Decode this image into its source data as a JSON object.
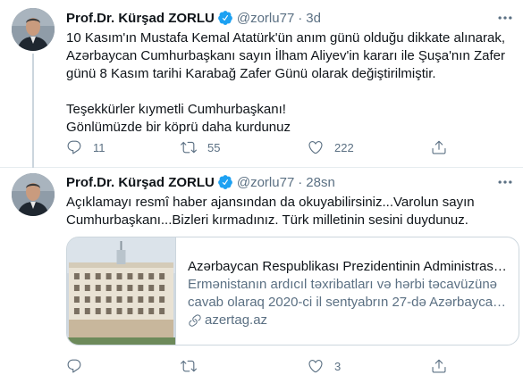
{
  "tweets": [
    {
      "author_name": "Prof.Dr. Kürşad ZORLU",
      "handle": "@zorlu77",
      "separator": "·",
      "time": "3d",
      "text_lines": [
        "10 Kasım'ın Mustafa Kemal Atatürk'ün anım günü olduğu dikkate alınarak,",
        "Azərbaycan Cumhurbaşkanı sayın İlham Aliyev'in kararı ile Şuşa'nın Zafer",
        "günü 8 Kasım tarihi Karabağ Zafer Günü olarak değiştirilmiştir.",
        "",
        "Teşekkürler kıymetli Cumhurbaşkanı!",
        "Gönlümüzde bir köprü daha kurdunuz"
      ],
      "replies": "11",
      "retweets": "55",
      "likes": "222"
    },
    {
      "author_name": "Prof.Dr. Kürşad ZORLU",
      "handle": "@zorlu77",
      "separator": "·",
      "time": "28sn",
      "text_lines": [
        "Açıklamayı resmî haber ajansından da okuyabilirsiniz...Varolun sayın",
        "Cumhurbaşkanı...Bizleri kırmadınız. Türk milletinin sesini duydunuz."
      ],
      "card": {
        "title": "Azərbaycan Respublikası Prezidentinin Administrasiy...",
        "description_lines": [
          "Ermənistanın ardıcıl təxribatları və hərbi təcavüzünə",
          "cavab olaraq 2020-ci il sentyabrın 27-də Azərbaycan ..."
        ],
        "domain": "azertag.az"
      },
      "replies": "",
      "retweets": "",
      "likes": "3"
    }
  ],
  "icons": {
    "verified": "verified-badge-icon",
    "more": "more-options-icon",
    "reply": "reply-icon",
    "retweet": "retweet-icon",
    "like": "heart-icon",
    "share": "share-icon",
    "link": "link-icon"
  },
  "colors": {
    "accent": "#1da1f2",
    "secondary_text": "#5b7083",
    "border": "#ccd6dd"
  }
}
